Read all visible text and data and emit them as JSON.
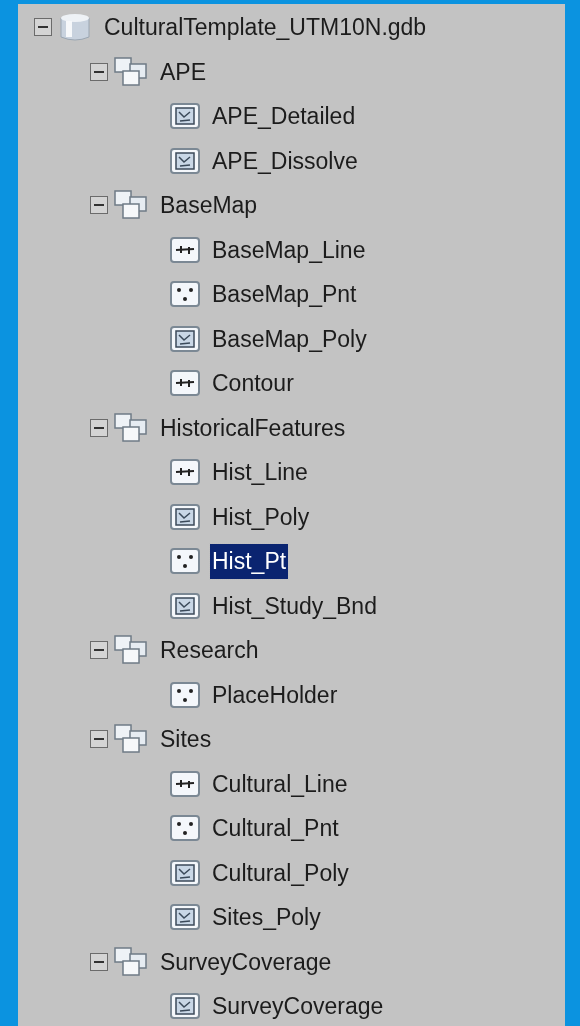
{
  "tree": [
    {
      "label": "CulturalTemplate_UTM10N.gdb",
      "kind": "database",
      "expanded": true,
      "selected": false,
      "children": [
        {
          "label": "APE",
          "kind": "dataset",
          "expanded": true,
          "selected": false,
          "children": [
            {
              "label": "APE_Detailed",
              "kind": "polygon",
              "selected": false
            },
            {
              "label": "APE_Dissolve",
              "kind": "polygon",
              "selected": false
            }
          ]
        },
        {
          "label": "BaseMap",
          "kind": "dataset",
          "expanded": true,
          "selected": false,
          "children": [
            {
              "label": "BaseMap_Line",
              "kind": "line",
              "selected": false
            },
            {
              "label": "BaseMap_Pnt",
              "kind": "point",
              "selected": false
            },
            {
              "label": "BaseMap_Poly",
              "kind": "polygon",
              "selected": false
            },
            {
              "label": "Contour",
              "kind": "line",
              "selected": false
            }
          ]
        },
        {
          "label": "HistoricalFeatures",
          "kind": "dataset",
          "expanded": true,
          "selected": false,
          "children": [
            {
              "label": "Hist_Line",
              "kind": "line",
              "selected": false
            },
            {
              "label": "Hist_Poly",
              "kind": "polygon",
              "selected": false
            },
            {
              "label": "Hist_Pt",
              "kind": "point",
              "selected": true
            },
            {
              "label": "Hist_Study_Bnd",
              "kind": "polygon",
              "selected": false
            }
          ]
        },
        {
          "label": "Research",
          "kind": "dataset",
          "expanded": true,
          "selected": false,
          "children": [
            {
              "label": "PlaceHolder",
              "kind": "point",
              "selected": false
            }
          ]
        },
        {
          "label": "Sites",
          "kind": "dataset",
          "expanded": true,
          "selected": false,
          "children": [
            {
              "label": "Cultural_Line",
              "kind": "line",
              "selected": false
            },
            {
              "label": "Cultural_Pnt",
              "kind": "point",
              "selected": false
            },
            {
              "label": "Cultural_Poly",
              "kind": "polygon",
              "selected": false
            },
            {
              "label": "Sites_Poly",
              "kind": "polygon",
              "selected": false
            }
          ]
        },
        {
          "label": "SurveyCoverage",
          "kind": "dataset",
          "expanded": true,
          "selected": false,
          "children": [
            {
              "label": "SurveyCoverage",
              "kind": "polygon",
              "selected": false
            }
          ]
        }
      ]
    }
  ]
}
